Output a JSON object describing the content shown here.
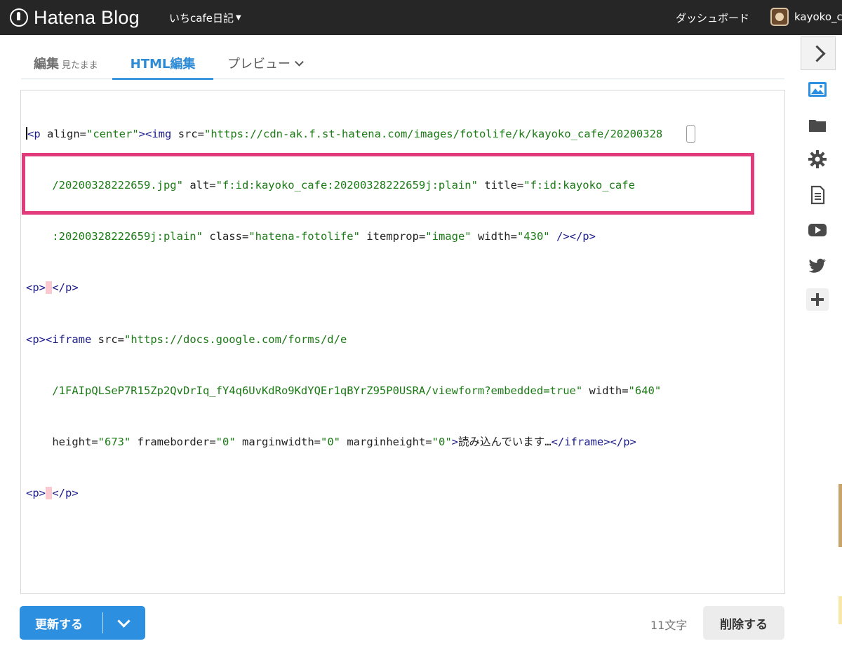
{
  "topbar": {
    "logo_text": "Hatena Blog",
    "blog_name": "いちcafe日記",
    "dashboard": "ダッシュボード",
    "username": "kayoko_c"
  },
  "tabs": {
    "edit_label": "編集",
    "edit_sub": "見たまま",
    "html_label": "HTML編集",
    "preview_label": "プレビュー"
  },
  "editor": {
    "lines": [
      "<p align=\"center\"><img src=\"https://cdn-ak.f.st-hatena.com/images/fotolife/k/kayoko_cafe/20200328",
      "    /20200328222659.jpg\" alt=\"f:id:kayoko_cafe:20200328222659j:plain\" title=\"f:id:kayoko_cafe",
      "    :20200328222659j:plain\" class=\"hatena-fotolife\" itemprop=\"image\" width=\"430\" /></p>",
      "<p> </p>",
      "<p><iframe src=\"https://docs.google.com/forms/d/e",
      "    /1FAIpQLSeP7R15Zp2QvDrIq_fY4q6UvKdRo9KdYQEr1qBYrZ95P0USRA/viewform?embedded=true\" width=\"640\"",
      "    height=\"673\" frameborder=\"0\" marginwidth=\"0\" marginheight=\"0\">読み込んでいます…</iframe></p>",
      "<p> </p>"
    ]
  },
  "sidebar": {
    "icons": [
      "chevron-right-icon",
      "photo-icon",
      "folder-icon",
      "gear-icon",
      "document-icon",
      "youtube-icon",
      "twitter-icon",
      "plus-icon"
    ]
  },
  "footer": {
    "update_label": "更新する",
    "char_count": "11文字",
    "delete_label": "削除する"
  },
  "colors": {
    "topbar": "#262626",
    "accent_blue": "#2d8fe0",
    "highlight_pink": "#e23b7c",
    "tag_color": "#1c1c8c",
    "value_color": "#1a7a14"
  }
}
